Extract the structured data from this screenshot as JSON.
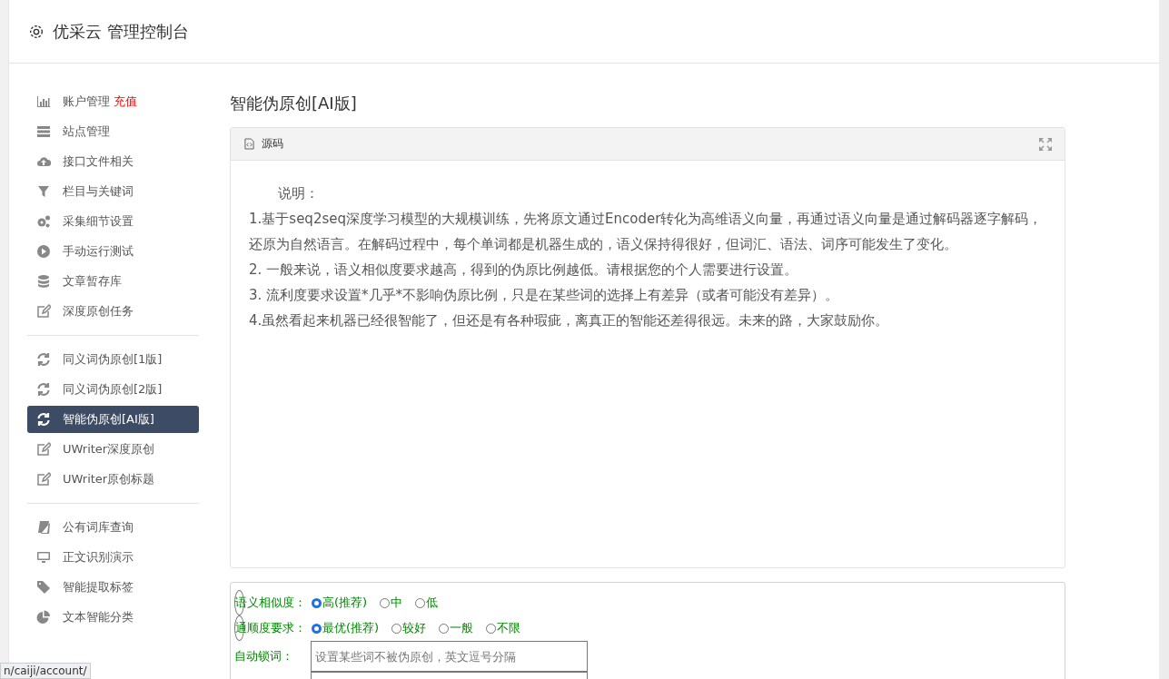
{
  "header": {
    "title": "优采云 管理控制台"
  },
  "sidebar": {
    "groups": [
      [
        {
          "label": "账户管理",
          "badge": "充值",
          "kind": "chart",
          "selected": false
        },
        {
          "label": "站点管理",
          "kind": "server",
          "selected": false
        },
        {
          "label": "接口文件相关",
          "kind": "cloud",
          "selected": false
        },
        {
          "label": "栏目与关键词",
          "kind": "filter",
          "selected": false
        },
        {
          "label": "采集细节设置",
          "kind": "gears",
          "selected": false
        },
        {
          "label": "手动运行测试",
          "kind": "play",
          "selected": false
        },
        {
          "label": "文章暂存库",
          "kind": "database",
          "selected": false
        },
        {
          "label": "深度原创任务",
          "kind": "edit",
          "selected": false
        }
      ],
      [
        {
          "label": "同义词伪原创[1版]",
          "kind": "refresh",
          "selected": false
        },
        {
          "label": "同义词伪原创[2版]",
          "kind": "refresh",
          "selected": false
        },
        {
          "label": "智能伪原创[AI版]",
          "kind": "refresh",
          "selected": true
        },
        {
          "label": "UWriter深度原创",
          "kind": "edit",
          "selected": false
        },
        {
          "label": "UWriter原创标题",
          "kind": "edit",
          "selected": false
        }
      ],
      [
        {
          "label": "公有词库查询",
          "kind": "book",
          "selected": false
        },
        {
          "label": "正文识别演示",
          "kind": "monitor",
          "selected": false
        },
        {
          "label": "智能提取标签",
          "kind": "tag",
          "selected": false
        },
        {
          "label": "文本智能分类",
          "kind": "pie",
          "selected": false
        }
      ]
    ]
  },
  "content": {
    "title": "智能伪原创[AI版]",
    "editor": {
      "tab": "源码",
      "heading": "说明：",
      "paragraphs": [
        "1.基于seq2seq深度学习模型的大规模训练，先将原文通过Encoder转化为高维语义向量，再通过语义向量是通过解码器逐字解码，还原为自然语言。在解码过程中，每个单词都是机器生成的，语义保持得很好，但词汇、语法、词序可能发生了变化。",
        "2. 一般来说，语义相似度要求越高，得到的伪原比例越低。请根据您的个人需要进行设置。",
        "3. 流利度要求设置*几乎*不影响伪原比例，只是在某些词的选择上有差异（或者可能没有差异）。",
        "4.虽然看起来机器已经很智能了，但还是有各种瑕疵，离真正的智能还差得很远。未来的路，大家鼓励你。"
      ]
    },
    "form": [
      {
        "kind": "radio",
        "label": "语义相似度：",
        "options": [
          {
            "label": "高(推荐)",
            "selected": true
          },
          {
            "label": "中",
            "selected": false
          },
          {
            "label": "低",
            "selected": false
          }
        ]
      },
      {
        "kind": "radio",
        "label": "通顺度要求：",
        "options": [
          {
            "label": "最优(推荐)",
            "selected": true
          },
          {
            "label": "较好",
            "selected": false
          },
          {
            "label": "一般",
            "selected": false
          },
          {
            "label": "不限",
            "selected": false
          }
        ]
      },
      {
        "kind": "input",
        "label": "自动锁词：",
        "placeholder": "设置某些词不被伪原创，英文逗号分隔"
      },
      {
        "kind": "input"
      }
    ]
  },
  "status_url": "n/caiji/account/"
}
